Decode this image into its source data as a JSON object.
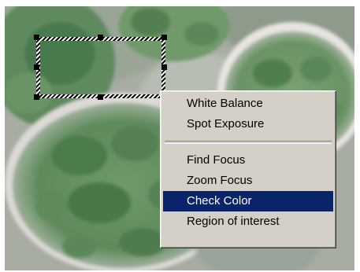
{
  "context_menu": {
    "group1": [
      {
        "label": "White Balance"
      },
      {
        "label": "Spot Exposure"
      }
    ],
    "group2": [
      {
        "label": "Find Focus"
      },
      {
        "label": "Zoom Focus"
      },
      {
        "label": "Check Color",
        "selected": true
      },
      {
        "label": "Region of interest"
      }
    ]
  },
  "colors": {
    "menu_background": "#d4d0c8",
    "selection_background": "#0a246a",
    "selection_text": "#ffffff"
  },
  "icons": {
    "roi_handle": "square-handle-icon"
  }
}
